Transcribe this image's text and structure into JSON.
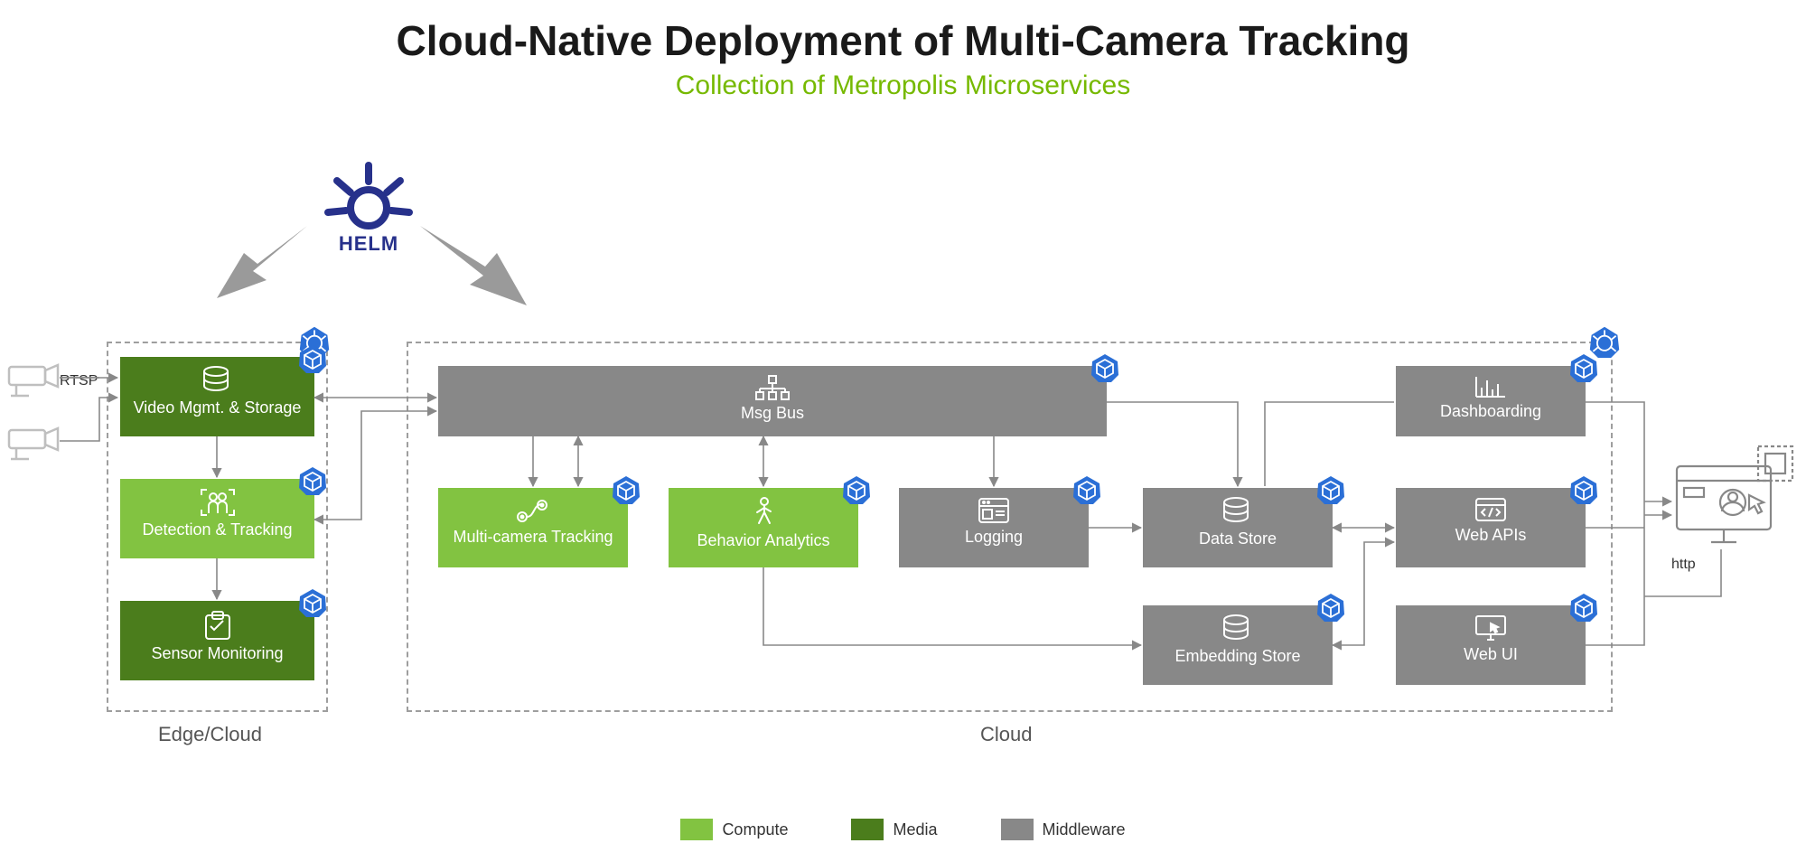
{
  "title": "Cloud-Native Deployment of Multi-Camera Tracking",
  "subtitle": "Collection of Metropolis Microservices",
  "helm_label": "HELM",
  "protocols": {
    "rtsp": "RTSP",
    "http": "http"
  },
  "clusters": {
    "edge": {
      "label": "Edge/Cloud"
    },
    "cloud": {
      "label": "Cloud"
    }
  },
  "services": {
    "vms": {
      "label": "Video Mgmt. & Storage",
      "tier": "media"
    },
    "det": {
      "label": "Detection & Tracking",
      "tier": "compute"
    },
    "sens": {
      "label": "Sensor Monitoring",
      "tier": "media"
    },
    "bus": {
      "label": "Msg Bus",
      "tier": "middleware"
    },
    "mct": {
      "label": "Multi-camera Tracking",
      "tier": "compute"
    },
    "beh": {
      "label": "Behavior Analytics",
      "tier": "compute"
    },
    "log": {
      "label": "Logging",
      "tier": "middleware"
    },
    "ds": {
      "label": "Data Store",
      "tier": "middleware"
    },
    "emb": {
      "label": "Embedding Store",
      "tier": "middleware"
    },
    "dash": {
      "label": "Dashboarding",
      "tier": "middleware"
    },
    "api": {
      "label": "Web APIs",
      "tier": "middleware"
    },
    "ui": {
      "label": "Web UI",
      "tier": "middleware"
    }
  },
  "legend": {
    "compute": "Compute",
    "media": "Media",
    "mw": "Middleware"
  },
  "colors": {
    "compute": "#82c341",
    "media": "#4b7d1c",
    "middleware": "#888888",
    "accent": "#76b900",
    "helm": "#27318b",
    "badge": "#2b6fd6"
  }
}
